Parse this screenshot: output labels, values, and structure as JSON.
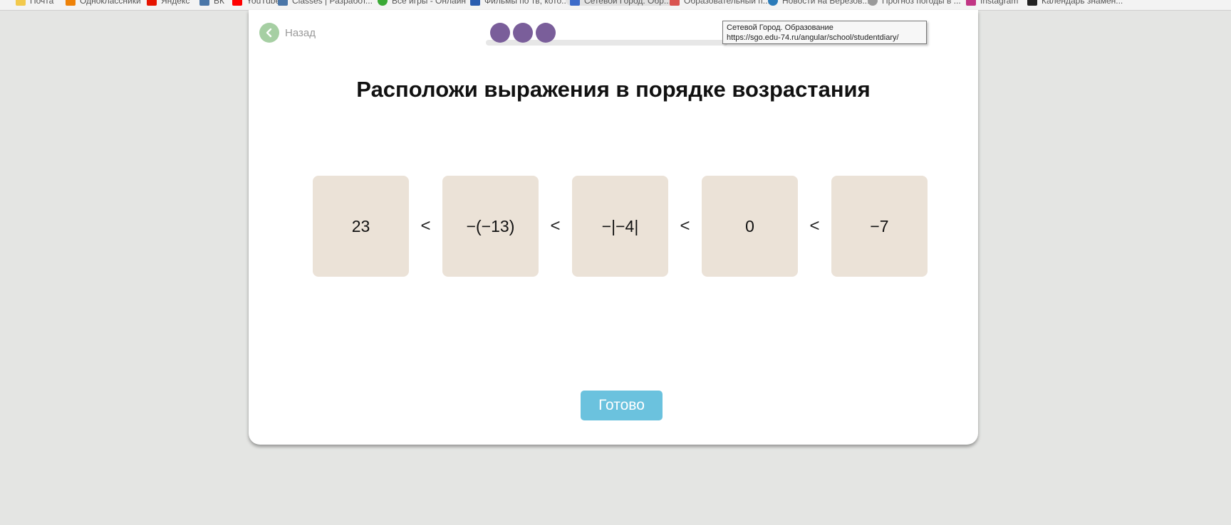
{
  "bookmarks": [
    {
      "label": "Почта",
      "icon": "mail-icon",
      "color": "#f2c94c"
    },
    {
      "label": "Одноклассники",
      "icon": "ok-icon",
      "color": "#ee8208"
    },
    {
      "label": "Яндекс",
      "icon": "yandex-icon",
      "color": "#e61400"
    },
    {
      "label": "ВК",
      "icon": "vk-icon",
      "color": "#4a76a8"
    },
    {
      "label": "YouTube",
      "icon": "youtube-icon",
      "color": "#ff0000"
    },
    {
      "label": "Classes | Разработ...",
      "icon": "vk-icon",
      "color": "#4a76a8"
    },
    {
      "label": "Все игры - Онлайн",
      "icon": "game-icon",
      "color": "#3aa935"
    },
    {
      "label": "Фильмы по тв, кото...",
      "icon": "film-icon",
      "color": "#2a5db0"
    },
    {
      "label": "Сетевой Город. Обр...",
      "icon": "school-icon",
      "color": "#3c6bc9"
    },
    {
      "label": "Образовательный п...",
      "icon": "edu-icon",
      "color": "#d9534f"
    },
    {
      "label": "Новости на Березов...",
      "icon": "news-icon",
      "color": "#2b7bb9"
    },
    {
      "label": "Прогноз погоды в ...",
      "icon": "weather-icon",
      "color": "#999999"
    },
    {
      "label": "Instagram",
      "icon": "instagram-icon",
      "color": "#c13584"
    },
    {
      "label": "Календарь знамен...",
      "icon": "calendar-icon",
      "color": "#222222"
    }
  ],
  "nav": {
    "back_label": "Назад"
  },
  "progress": {
    "steps_done": 3
  },
  "tooltip": {
    "title": "Сетевой Город. Образование",
    "url": "https://sgo.edu-74.ru/angular/school/studentdiary/"
  },
  "task": {
    "title": "Расположи выражения в порядке возрастания",
    "tiles": [
      "23",
      "−(−13)",
      "−|−4|",
      "0",
      "−7"
    ],
    "separator": "<"
  },
  "actions": {
    "done_label": "Готово"
  },
  "colors": {
    "background": "#e4e5e3",
    "tile": "#ebe2d7",
    "progress_dot": "#7a5e9a",
    "back_button": "#a6cfa3",
    "done_button": "#6bc2de"
  }
}
